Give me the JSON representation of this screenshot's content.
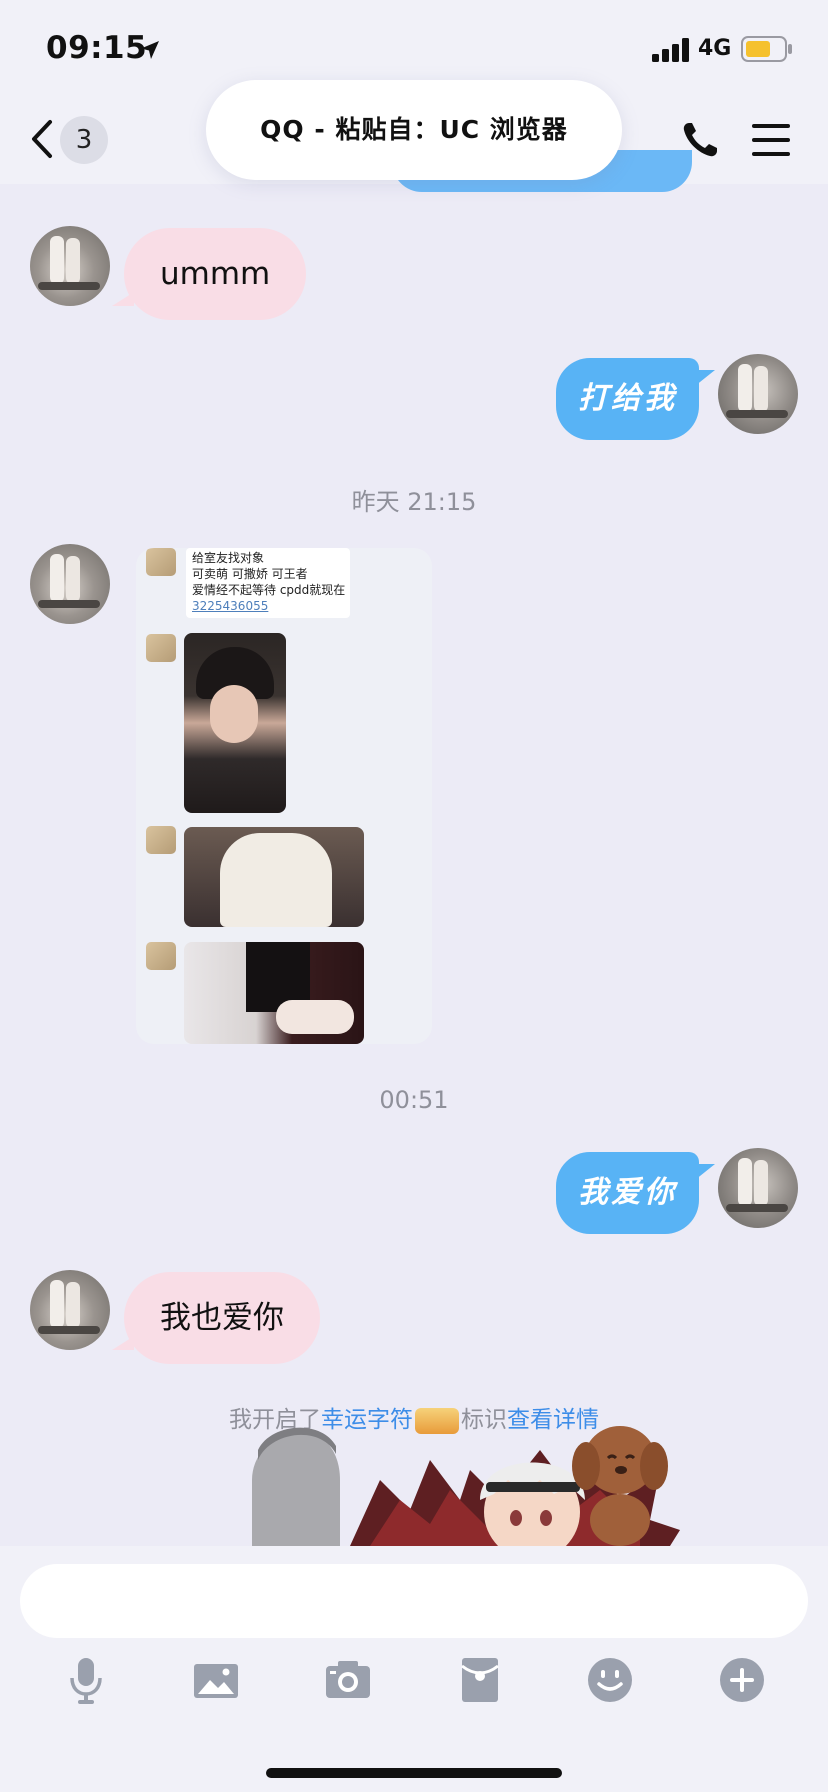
{
  "status_bar": {
    "time": "09:15",
    "network": "4G",
    "battery_color": "#f5c12e"
  },
  "nav": {
    "back_count": "3",
    "paste_banner": "QQ - 粘贴自：UC 浏览器"
  },
  "messages": {
    "m1_text": "ummm",
    "m2_text": "打给我",
    "time_1": "昨天 21:15",
    "image_note": {
      "line1": "给室友找对象",
      "line2": "可卖萌  可撒娇  可王者",
      "line3": "爱情经不起等待 cpdd就现在",
      "qq": "3225436055"
    },
    "time_2": "00:51",
    "m3_text": "我爱你",
    "m4_text": "我也爱你",
    "lucky": {
      "prefix": "我开启了",
      "link1": "幸运字符",
      "middle": "标识",
      "link2": "查看详情"
    }
  },
  "colors": {
    "incoming_bubble": "#f9dde6",
    "outgoing_bubble": "#58b3f5",
    "link": "#3d8de8"
  },
  "toolbar": {
    "icons": [
      "microphone-icon",
      "image-icon",
      "camera-icon",
      "red-packet-icon",
      "emoji-icon",
      "plus-icon"
    ]
  }
}
